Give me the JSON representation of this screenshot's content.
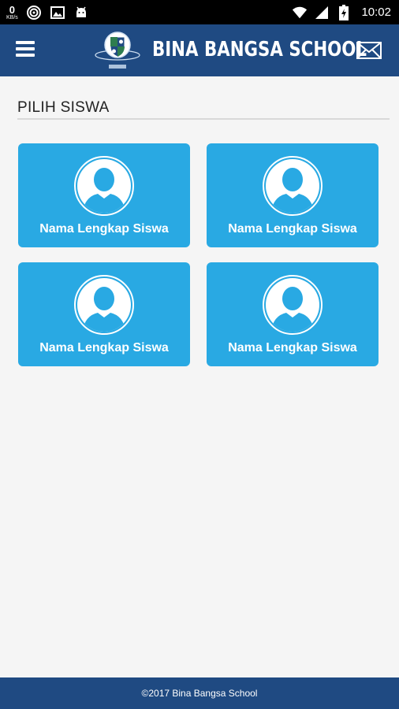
{
  "status_bar": {
    "speed_value": "0",
    "speed_unit": "KB/s",
    "time": "10:02",
    "icons": [
      "data-speed",
      "hotspot-icon",
      "image-icon",
      "android-icon",
      "wifi-icon",
      "signal-icon",
      "battery-charging-icon"
    ]
  },
  "app_bar": {
    "title": "BINA BANGSA SCHOOL",
    "menu_icon": "hamburger-menu-icon",
    "mail_icon": "envelope-icon",
    "logo_icon": "school-crest-logo"
  },
  "main": {
    "section_title": "PILIH SISWA",
    "students": [
      {
        "name": "Nama Lengkap Siswa"
      },
      {
        "name": "Nama Lengkap Siswa"
      },
      {
        "name": "Nama Lengkap Siswa"
      },
      {
        "name": "Nama Lengkap Siswa"
      }
    ]
  },
  "footer": {
    "text": "©2017 Bina Bangsa School"
  },
  "colors": {
    "app_bar": "#1f4a82",
    "card": "#29a9e3",
    "background": "#f5f5f5"
  }
}
